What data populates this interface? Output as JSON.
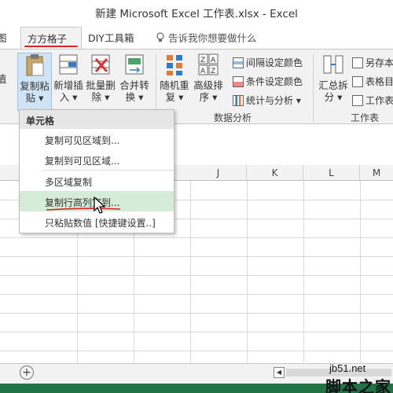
{
  "window": {
    "title": "新建 Microsoft Excel 工作表.xlsx - Excel"
  },
  "tabs": {
    "cut": "图",
    "active": "方方格子",
    "diy": "DIY工具箱",
    "tell_me": "告诉我你想要做什么"
  },
  "ribbon": {
    "cut_left": "值",
    "copy_paste": [
      "复制粘",
      "贴 ▾"
    ],
    "insert": [
      "新增插",
      "入 ▾"
    ],
    "batch_delete": [
      "批量删",
      "除 ▾"
    ],
    "merge_convert": [
      "合并转",
      "换 ▾"
    ],
    "random_repeat": [
      "随机重",
      "复 ▾"
    ],
    "advanced_sort": [
      "高级排",
      "序 ▾"
    ],
    "interval_color": "间隔设定颜色",
    "cond_color": "条件设定颜色",
    "stats_analysis": "统计与分析 ▾",
    "summary_split": [
      "汇总拆",
      "分 ▾"
    ],
    "save_as": "另存本",
    "table_dir": "表格目",
    "worksheet": "工作表",
    "group_data_analysis": "数据分析",
    "group_worksheet": "工作表"
  },
  "columns": [
    "J",
    "K",
    "L",
    "M"
  ],
  "menu": {
    "header": "单元格",
    "items": [
      "复制可见区域到...",
      "复制到可见区域...",
      "多区域复制",
      "复制行高列宽到...",
      "只粘贴数值 [快捷键设置..]"
    ]
  },
  "sheetbar": {
    "add": "+"
  },
  "watermark": {
    "site": "jb51.net",
    "name": "脚本之家"
  },
  "colors": {
    "accent": "#217346",
    "highlight": "#d5ecd9",
    "red_marks": "#d22"
  }
}
